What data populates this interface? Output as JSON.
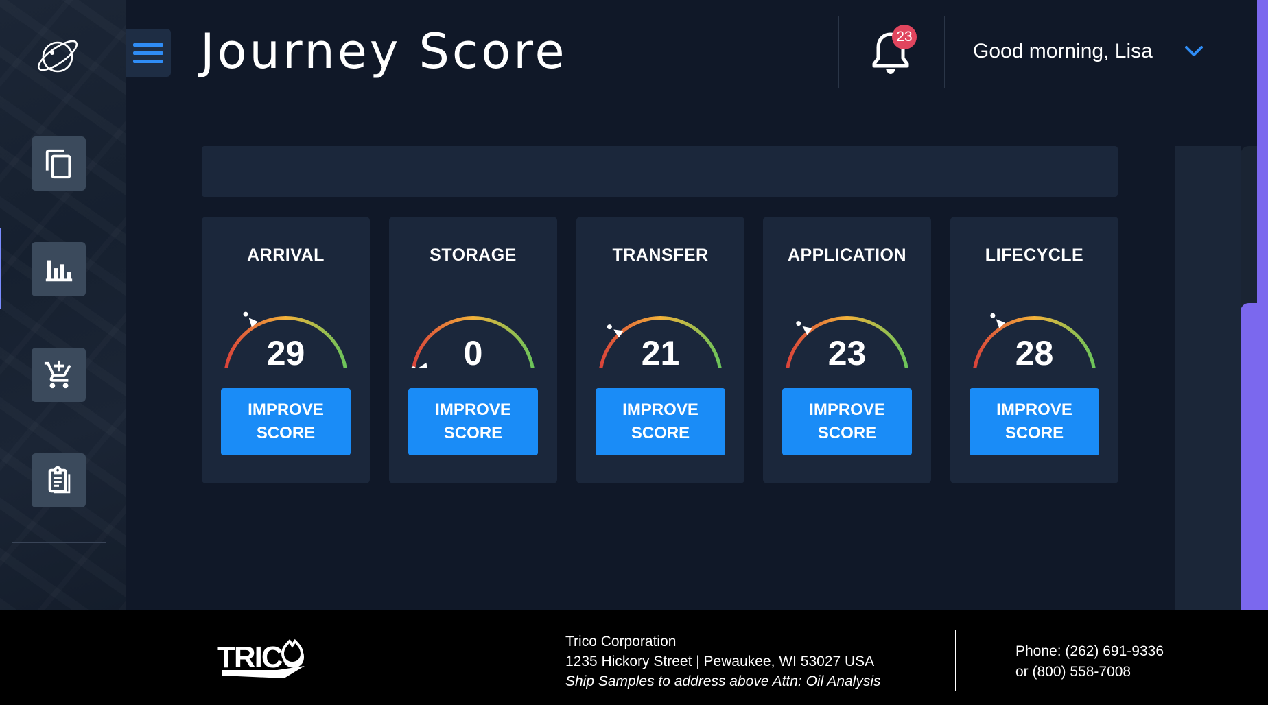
{
  "header": {
    "title": "Journey Score",
    "notification_count": "23",
    "greeting": "Good morning, Lisa"
  },
  "sidebar": {
    "items": [
      {
        "name": "documents",
        "icon": "copy-icon"
      },
      {
        "name": "reports",
        "icon": "bar-chart-icon"
      },
      {
        "name": "order",
        "icon": "add-cart-icon"
      },
      {
        "name": "clipboard",
        "icon": "clipboard-icon"
      }
    ]
  },
  "cards": [
    {
      "title": "ARRIVAL",
      "score": "29",
      "button_line1": "IMPROVE",
      "button_line2": "SCORE"
    },
    {
      "title": "STORAGE",
      "score": "0",
      "button_line1": "IMPROVE",
      "button_line2": "SCORE"
    },
    {
      "title": "TRANSFER",
      "score": "21",
      "button_line1": "IMPROVE",
      "button_line2": "SCORE"
    },
    {
      "title": "APPLICATION",
      "score": "23",
      "button_line1": "IMPROVE",
      "button_line2": "SCORE"
    },
    {
      "title": "LIFECYCLE",
      "score": "28",
      "button_line1": "IMPROVE",
      "button_line2": "SCORE"
    }
  ],
  "footer": {
    "logo_text": "TRICO",
    "company": "Trico Corporation",
    "address": "1235 Hickory Street | Pewaukee, WI 53027 USA",
    "note": "Ship Samples to address above Attn: Oil Analysis",
    "phone1": "Phone: (262) 691-9336",
    "phone2": "or (800) 558-7008"
  },
  "colors": {
    "accent": "#1a8cf7",
    "background": "#101828",
    "card": "#1b273b",
    "badge": "#e0455e",
    "scroll": "#7b68ee",
    "gauge_low": "#d9443a",
    "gauge_mid": "#f3b23a",
    "gauge_high": "#6cc45a"
  }
}
